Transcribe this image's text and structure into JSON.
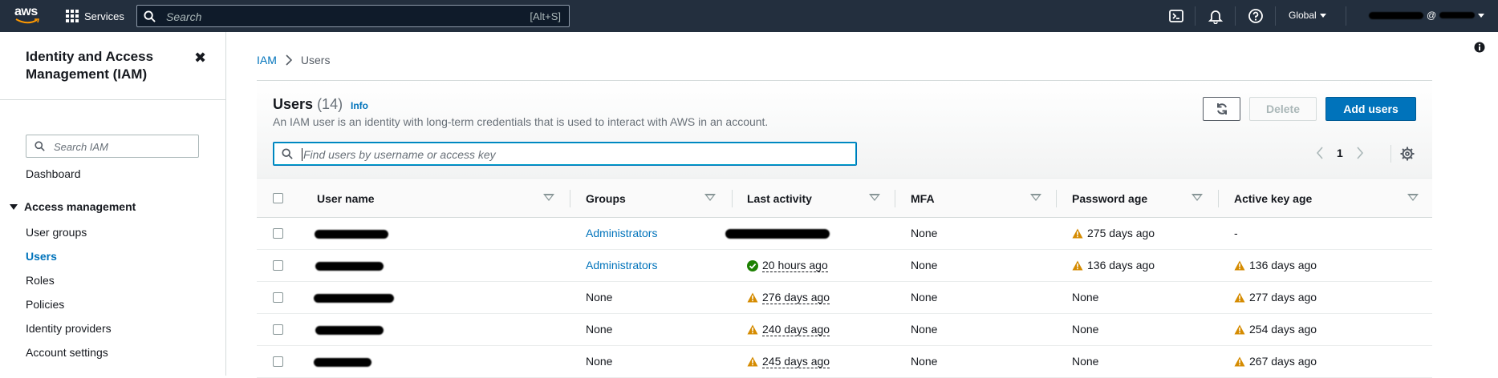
{
  "topnav": {
    "logo": "aws",
    "services_label": "Services",
    "search_placeholder": "Search",
    "search_shortcut": "[Alt+S]",
    "region": "Global",
    "account_at": "@"
  },
  "sidebar": {
    "title": "Identity and Access Management (IAM)",
    "close_icon": "✖",
    "search_placeholder": "Search IAM",
    "dashboard": "Dashboard",
    "section": "Access management",
    "items": [
      "User groups",
      "Users",
      "Roles",
      "Policies",
      "Identity providers",
      "Account settings"
    ],
    "active_item": "Users"
  },
  "breadcrumb": {
    "root": "IAM",
    "current": "Users"
  },
  "users": {
    "title": "Users",
    "count": "(14)",
    "info": "Info",
    "description": "An IAM user is an identity with long-term credentials that is used to interact with AWS in an account.",
    "refresh_icon": "refresh-icon",
    "delete_label": "Delete",
    "add_label": "Add users",
    "filter_placeholder": "Find users by username or access key",
    "page": "1"
  },
  "table": {
    "columns": [
      "User name",
      "Groups",
      "Last activity",
      "MFA",
      "Password age",
      "Active key age"
    ],
    "rows": [
      {
        "groups": "Administrators",
        "groups_link": true,
        "last_activity": "",
        "activity_status": "redacted",
        "mfa": "None",
        "password_age": "275 days ago",
        "password_warn": true,
        "key_age": "-",
        "key_warn": false
      },
      {
        "groups": "Administrators",
        "groups_link": true,
        "last_activity": "20 hours ago",
        "activity_status": "ok",
        "mfa": "None",
        "password_age": "136 days ago",
        "password_warn": true,
        "key_age": "136 days ago",
        "key_warn": true
      },
      {
        "groups": "None",
        "groups_link": false,
        "last_activity": "276 days ago",
        "activity_status": "warn",
        "mfa": "None",
        "password_age": "None",
        "password_warn": false,
        "key_age": "277 days ago",
        "key_warn": true
      },
      {
        "groups": "None",
        "groups_link": false,
        "last_activity": "240 days ago",
        "activity_status": "warn",
        "mfa": "None",
        "password_age": "None",
        "password_warn": false,
        "key_age": "254 days ago",
        "key_warn": true
      },
      {
        "groups": "None",
        "groups_link": false,
        "last_activity": "245 days ago",
        "activity_status": "warn",
        "mfa": "None",
        "password_age": "None",
        "password_warn": false,
        "key_age": "267 days ago",
        "key_warn": true
      }
    ]
  },
  "colors": {
    "nav_bg": "#232f3e",
    "link": "#0073bb",
    "primary_button": "#0073bb",
    "warning": "#d58b00",
    "success": "#1d8102"
  }
}
